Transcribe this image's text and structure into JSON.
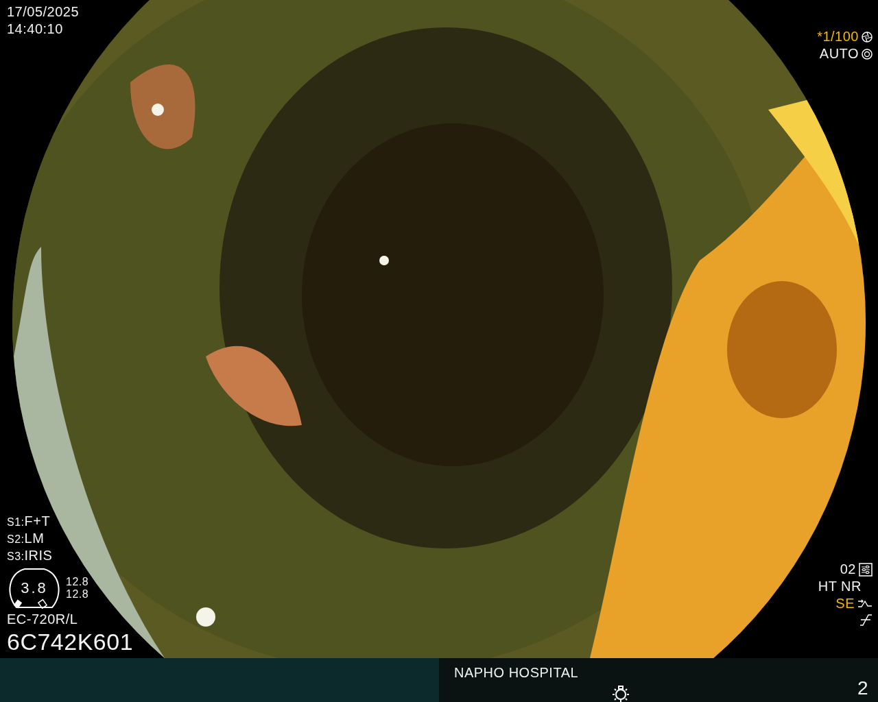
{
  "datetime": {
    "date": "17/05/2025",
    "time": "14:40:10"
  },
  "shutter": {
    "speed": "*1/100",
    "highlighted": true,
    "mode": "AUTO"
  },
  "scope_settings": [
    {
      "key": "S1:",
      "value": "F+T"
    },
    {
      "key": "S2:",
      "value": "LM"
    },
    {
      "key": "S3:",
      "value": "IRIS"
    }
  ],
  "gauge": {
    "value": "3.8",
    "readings": [
      "12.8",
      "12.8"
    ]
  },
  "scope_model": "EC-720R/L",
  "serial": "6C742K601",
  "image_settings": {
    "preset": "02",
    "modes": "HT NR",
    "enhancement": {
      "label": "SE",
      "active": true
    }
  },
  "footer": {
    "hospital": "NAPHO HOSPITAL",
    "page": "2"
  }
}
